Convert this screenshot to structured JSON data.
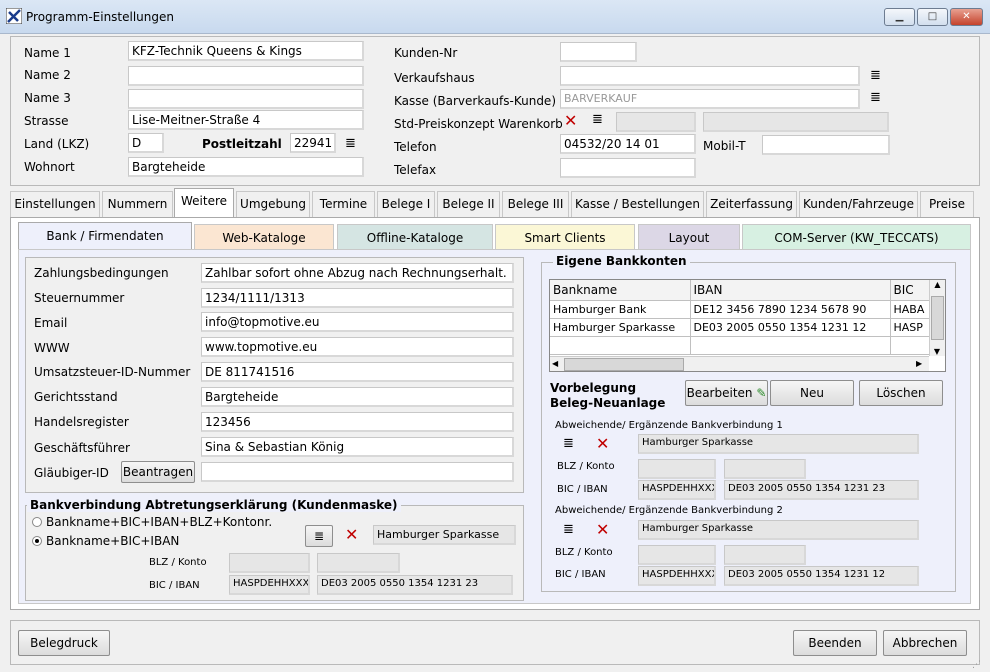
{
  "window": {
    "title": "Programm-Einstellungen",
    "min": "▁",
    "max": "□",
    "close": "✕"
  },
  "header": {
    "name1_label": "Name 1",
    "name1": "KFZ-Technik Queens & Kings",
    "name2_label": "Name 2",
    "name2": "",
    "name3_label": "Name 3",
    "name3": "",
    "strasse_label": "Strasse",
    "strasse": "Lise-Meitner-Straße 4",
    "land_label": "Land (LKZ)",
    "land": "D",
    "plz_label": "Postleitzahl",
    "plz": "22941",
    "wohnort_label": "Wohnort",
    "wohnort": "Bargteheide",
    "kunden_label": "Kunden-Nr",
    "kunden": "",
    "verkaufshaus_label": "Verkaufshaus",
    "verkaufshaus": "",
    "kasse_label": "Kasse (Barverkaufs-Kunde)",
    "kasse": "BARVERKAUF",
    "preis_label": "Std-Preiskonzept Warenkorb",
    "telefon_label": "Telefon",
    "telefon": "04532/20 14 01",
    "mobil_label": "Mobil-T",
    "mobil": "",
    "telefax_label": "Telefax",
    "telefax": ""
  },
  "tabs": [
    "Einstellungen",
    "Nummern",
    "Weitere",
    "Umgebung",
    "Termine",
    "Belege I",
    "Belege II",
    "Belege III",
    "Kasse / Bestellungen",
    "Zeiterfassung",
    "Kunden/Fahrzeuge",
    "Preise"
  ],
  "subtabs": [
    "Bank / Firmendaten",
    "Web-Kataloge",
    "Offline-Kataloge",
    "Smart Clients",
    "Layout",
    "COM-Server (KW_TECCATS)"
  ],
  "firm": [
    {
      "label": "Zahlungsbedingungen",
      "value": "Zahlbar sofort ohne Abzug nach Rechnungserhalt."
    },
    {
      "label": "Steuernummer",
      "value": "1234/1111/1313"
    },
    {
      "label": "Email",
      "value": "info@topmotive.eu"
    },
    {
      "label": "WWW",
      "value": "www.topmotive.eu"
    },
    {
      "label": "Umsatzsteuer-ID-Nummer",
      "value": "DE 811741516"
    },
    {
      "label": "Gerichtsstand",
      "value": "Bargteheide"
    },
    {
      "label": "Handelsregister",
      "value": "123456"
    },
    {
      "label": "Geschäftsführer",
      "value": "Sina & Sebastian König"
    },
    {
      "label": "Gläubiger-ID",
      "value": ""
    }
  ],
  "beantragen": "Beantragen",
  "abtretung": {
    "title": "Bankverbindung Abtretungserklärung (Kundenmaske)",
    "opt1": "Bankname+BIC+IBAN+BLZ+Kontonr.",
    "opt2": "Bankname+BIC+IBAN",
    "bank": "Hamburger Sparkasse",
    "blz_label": "BLZ / Konto",
    "blz": "",
    "konto": "",
    "bic_label": "BIC / IBAN",
    "bic": "HASPDEHHXXX",
    "iban": "DE03 2005 0550 1354 1231 23"
  },
  "eigene": {
    "title": "Eigene Bankkonten",
    "cols": [
      "Bankname",
      "IBAN",
      "BIC"
    ],
    "rows": [
      [
        "Hamburger Bank",
        "DE12 3456 7890 1234 5678 90",
        "HABA"
      ],
      [
        "Hamburger Sparkasse",
        "DE03 2005 0550 1354 1231 12",
        "HASP"
      ]
    ],
    "vorbelegung": "Vorbelegung",
    "neuanlage": "Beleg-Neuanlage",
    "bearbeiten": "Bearbeiten",
    "neu": "Neu",
    "loeschen": "Löschen",
    "abw1": "Abweichende/ Ergänzende Bankverbindung 1",
    "bank1": "Hamburger Sparkasse",
    "bic1": "HASPDEHHXXX",
    "iban1": "DE03 2005 0550 1354 1231 23",
    "abw2": "Abweichende/ Ergänzende Bankverbindung 2",
    "bank2": "Hamburger Sparkasse",
    "bic2": "HASPDEHHXXX",
    "iban2": "DE03 2005 0550 1354 1231 12",
    "blz_label": "BLZ / Konto",
    "bic_label": "BIC / IBAN"
  },
  "footer": {
    "belegdruck": "Belegdruck",
    "beenden": "Beenden",
    "abbrechen": "Abbrechen"
  },
  "colors": {
    "web": "#fbe6d2",
    "offline": "#d5e5e3",
    "smart": "#fbf7d6",
    "layout": "#dcd7e6",
    "com": "#d7f0e2",
    "pane": "#eef0fb"
  }
}
